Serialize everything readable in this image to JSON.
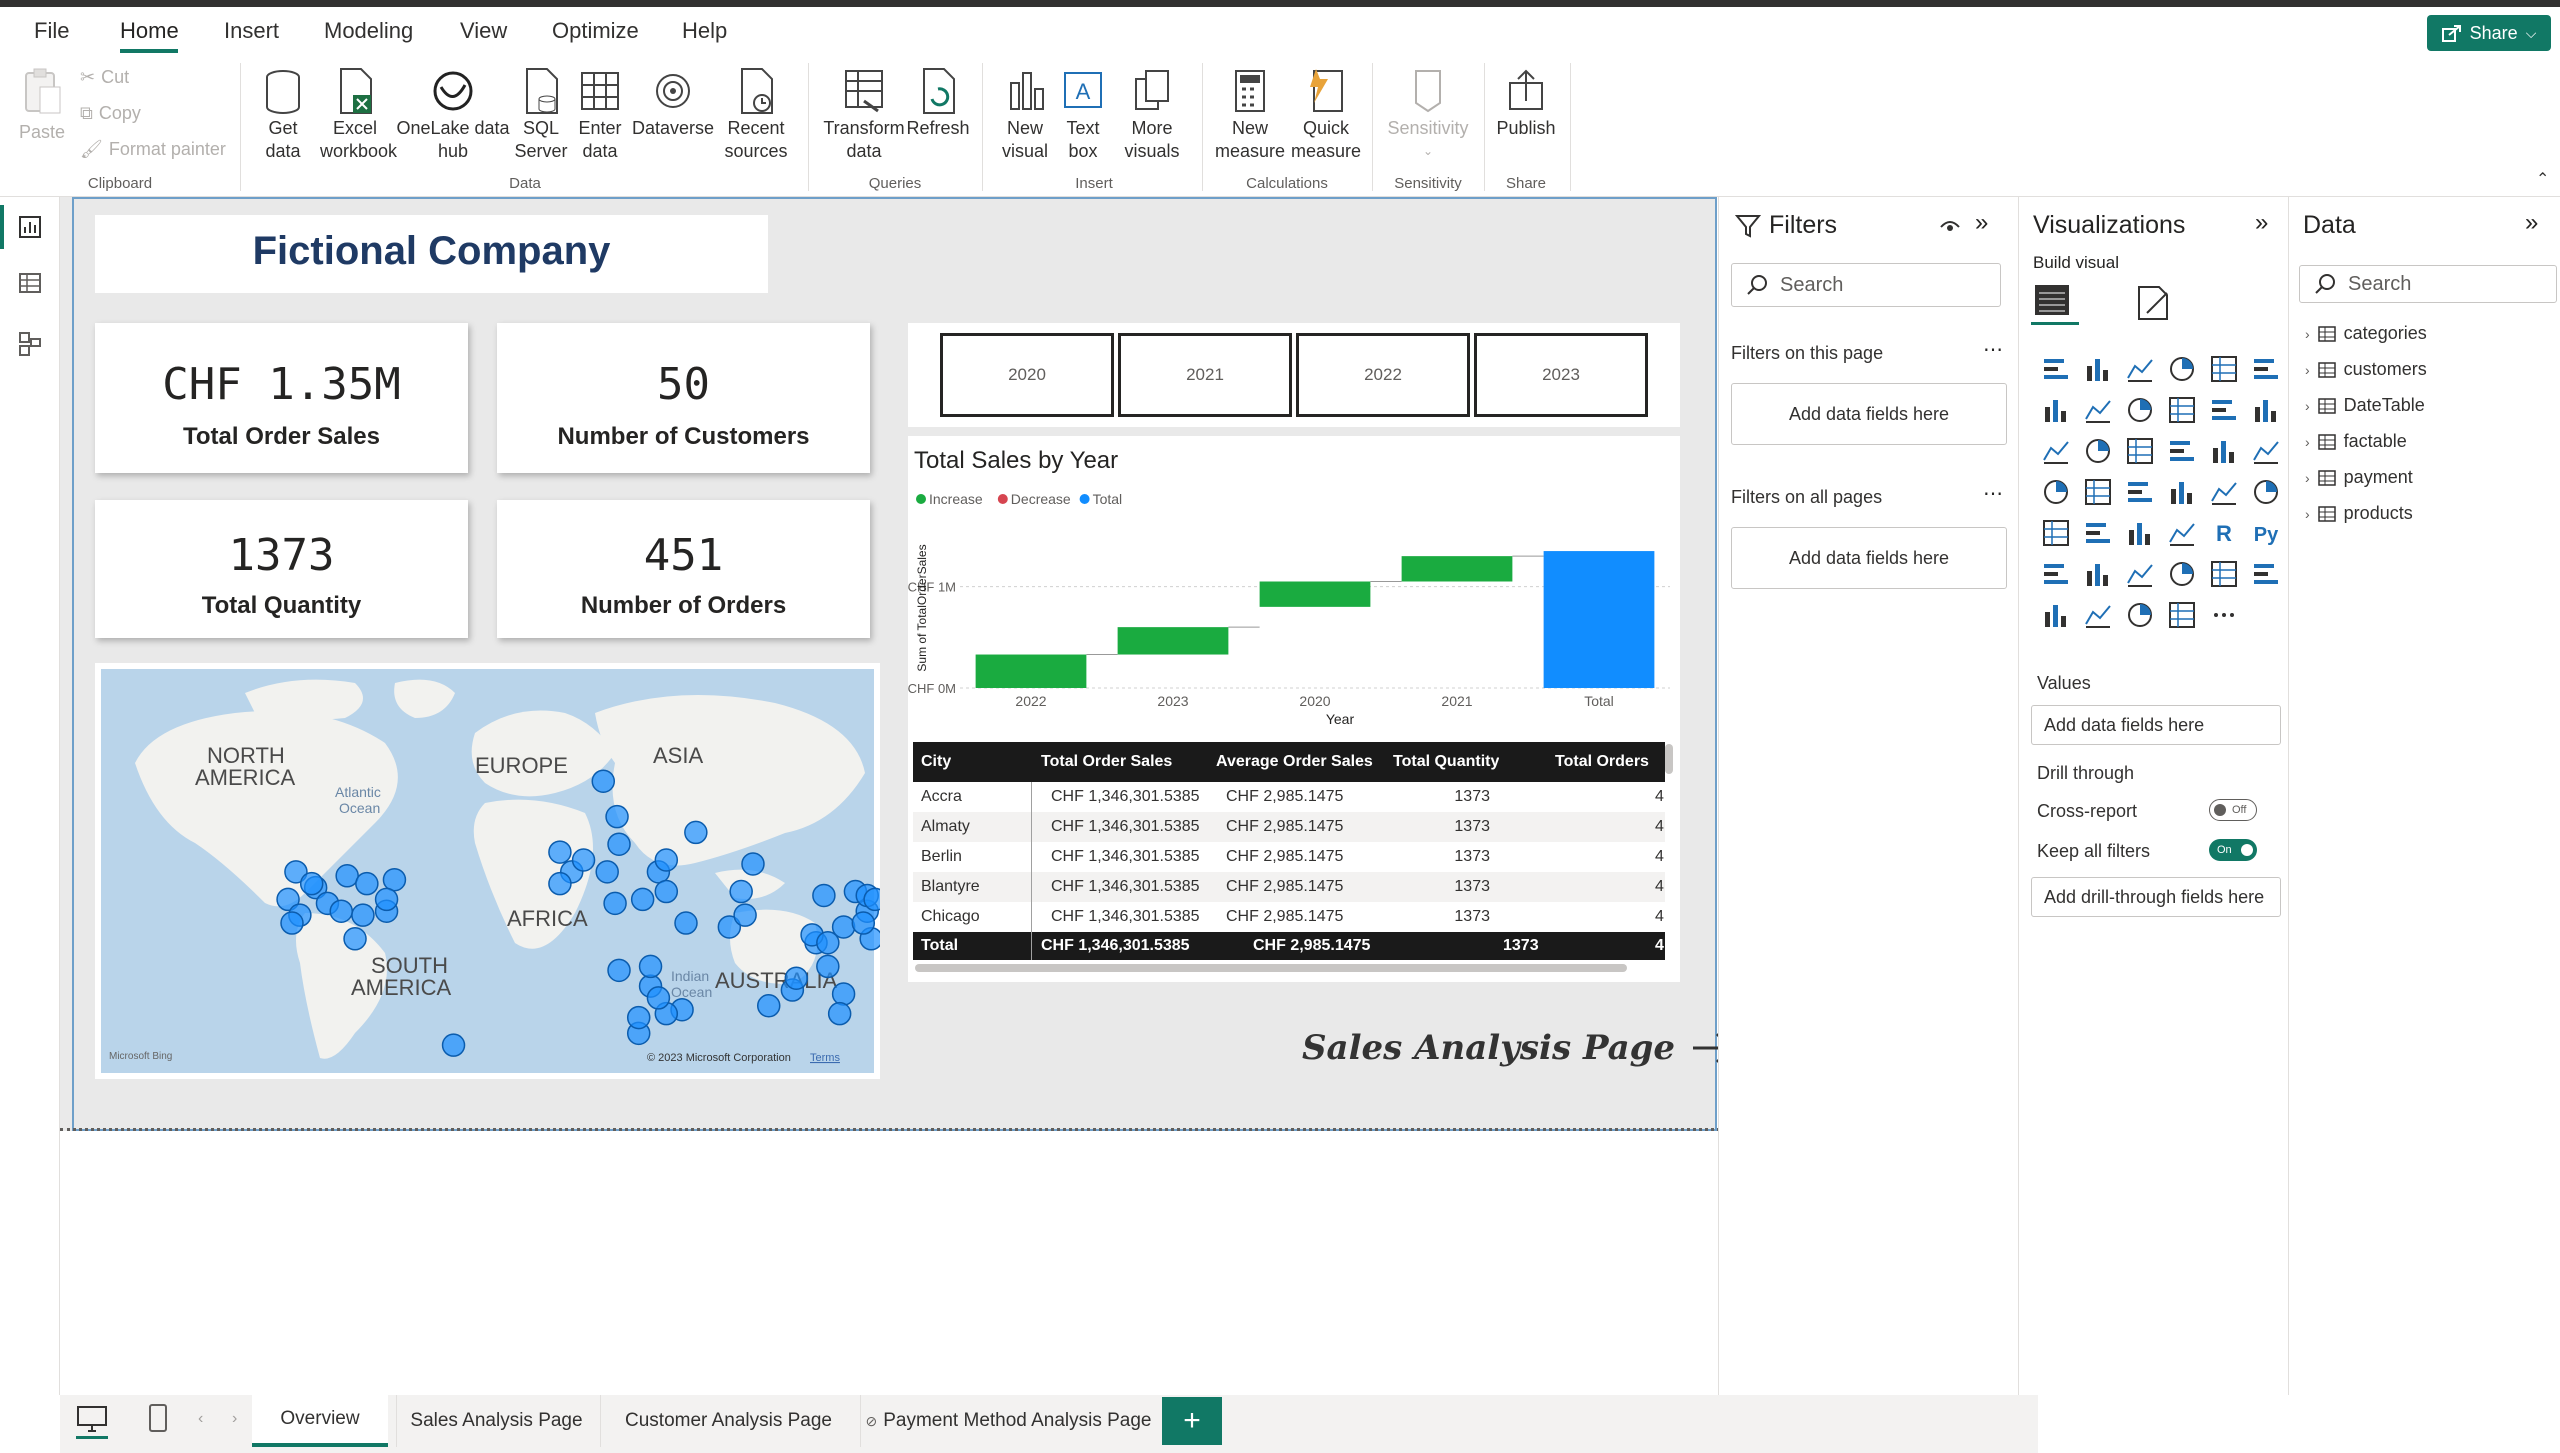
{
  "menu": {
    "items": [
      "File",
      "Home",
      "Insert",
      "Modeling",
      "View",
      "Optimize",
      "Help"
    ],
    "share_label": "Share"
  },
  "ribbon": {
    "clipboard": {
      "paste": "Paste",
      "cut": "Cut",
      "copy": "Copy",
      "format_painter": "Format painter",
      "group": "Clipboard"
    },
    "data": {
      "get_data": [
        "Get",
        "data"
      ],
      "excel": [
        "Excel",
        "workbook"
      ],
      "onelake": [
        "OneLake data",
        "hub"
      ],
      "sql": [
        "SQL",
        "Server"
      ],
      "enter": [
        "Enter",
        "data"
      ],
      "dataverse": "Dataverse",
      "recent": [
        "Recent",
        "sources"
      ],
      "group": "Data"
    },
    "queries": {
      "transform": [
        "Transform",
        "data"
      ],
      "refresh": "Refresh",
      "group": "Queries"
    },
    "insert": {
      "new_visual": [
        "New",
        "visual"
      ],
      "text_box": [
        "Text",
        "box"
      ],
      "more_visuals": [
        "More",
        "visuals"
      ],
      "group": "Insert"
    },
    "calculations": {
      "new_measure": [
        "New",
        "measure"
      ],
      "quick_measure": [
        "Quick",
        "measure"
      ],
      "group": "Calculations"
    },
    "sensitivity": {
      "label": "Sensitivity",
      "group": "Sensitivity"
    },
    "share": {
      "publish": "Publish",
      "group": "Share"
    }
  },
  "report": {
    "title": "Fictional Company",
    "kpis": [
      {
        "value": "CHF 1.35M",
        "label": "Total Order Sales"
      },
      {
        "value": "50",
        "label": "Number of Customers"
      },
      {
        "value": "1373",
        "label": "Total Quantity"
      },
      {
        "value": "451",
        "label": "Number of Orders"
      }
    ],
    "years": [
      "2020",
      "2021",
      "2022",
      "2023"
    ],
    "map": {
      "labels": {
        "north_america": "NORTH",
        "america": "AMERICA",
        "europe": "EUROPE",
        "asia": "ASIA",
        "atlantic": "Atlantic",
        "ocean": "Ocean",
        "south": "SOUTH",
        "south_america": "AMERICA",
        "africa": "AFRICA",
        "indian": "Indian",
        "indian_ocean": "Ocean",
        "australia": "AUSTRALIA"
      },
      "attribution": "© 2023 Microsoft Corporation",
      "terms": "Terms",
      "bing": "Microsoft Bing"
    },
    "nav_link": "Sales Analysis Page",
    "table": {
      "headers": [
        "City",
        "Total Order Sales",
        "Average Order Sales",
        "Total Quantity",
        "Total Orders"
      ],
      "rows": [
        [
          "Accra",
          "CHF 1,346,301.5385",
          "CHF 2,985.1475",
          "1373",
          "4"
        ],
        [
          "Almaty",
          "CHF 1,346,301.5385",
          "CHF 2,985.1475",
          "1373",
          "4"
        ],
        [
          "Berlin",
          "CHF 1,346,301.5385",
          "CHF 2,985.1475",
          "1373",
          "4"
        ],
        [
          "Blantyre",
          "CHF 1,346,301.5385",
          "CHF 2,985.1475",
          "1373",
          "4"
        ],
        [
          "Chicago",
          "CHF 1,346,301.5385",
          "CHF 2,985.1475",
          "1373",
          "4"
        ]
      ],
      "total": [
        "Total",
        "CHF 1,346,301.5385",
        "CHF 2,985.1475",
        "1373",
        "4"
      ]
    }
  },
  "chart_data": {
    "type": "bar",
    "subtype": "waterfall",
    "title": "Total Sales by Year",
    "xlabel": "Year",
    "ylabel": "Sum of TotalOrderSales",
    "categories": [
      "2022",
      "2023",
      "2020",
      "2021",
      "Total"
    ],
    "legend": [
      "Increase",
      "Decrease",
      "Total"
    ],
    "legend_colors": [
      "#1aab40",
      "#d64550",
      "#118dff"
    ],
    "yticks": [
      "CHF 0M",
      "CHF 1M"
    ],
    "ylim": [
      0,
      1.4
    ],
    "steps": [
      {
        "category": "2022",
        "start": 0,
        "end": 0.33,
        "kind": "Increase"
      },
      {
        "category": "2023",
        "start": 0.33,
        "end": 0.6,
        "kind": "Increase"
      },
      {
        "category": "2020",
        "start": 0.8,
        "end": 1.05,
        "kind": "Increase"
      },
      {
        "category": "2021",
        "start": 1.05,
        "end": 1.3,
        "kind": "Increase"
      },
      {
        "category": "Total",
        "start": 0,
        "end": 1.35,
        "kind": "Total"
      }
    ]
  },
  "filters": {
    "title": "Filters",
    "search_placeholder": "Search",
    "this_page": "Filters on this page",
    "all_pages": "Filters on all pages",
    "add_fields": "Add data fields here"
  },
  "visualizations": {
    "title": "Visualizations",
    "build_visual": "Build visual",
    "values": "Values",
    "add_fields": "Add data fields here",
    "drill_through": "Drill through",
    "cross_report": "Cross-report",
    "cross_report_state": "Off",
    "keep_filters": "Keep all filters",
    "keep_filters_state": "On",
    "add_drill": "Add drill-through fields here",
    "r_label": "R",
    "py_label": "Py"
  },
  "data_pane": {
    "title": "Data",
    "search_placeholder": "Search",
    "tables": [
      "categories",
      "customers",
      "DateTable",
      "factable",
      "payment",
      "products"
    ]
  },
  "tabs": [
    "Overview",
    "Sales Analysis Page",
    "Customer Analysis Page",
    "Payment Method Analysis Page"
  ],
  "colors": {
    "accent": "#117865",
    "title_blue": "#1f3a64",
    "increase": "#1aab40",
    "total": "#118dff",
    "map_dot": "#1e90ff"
  }
}
